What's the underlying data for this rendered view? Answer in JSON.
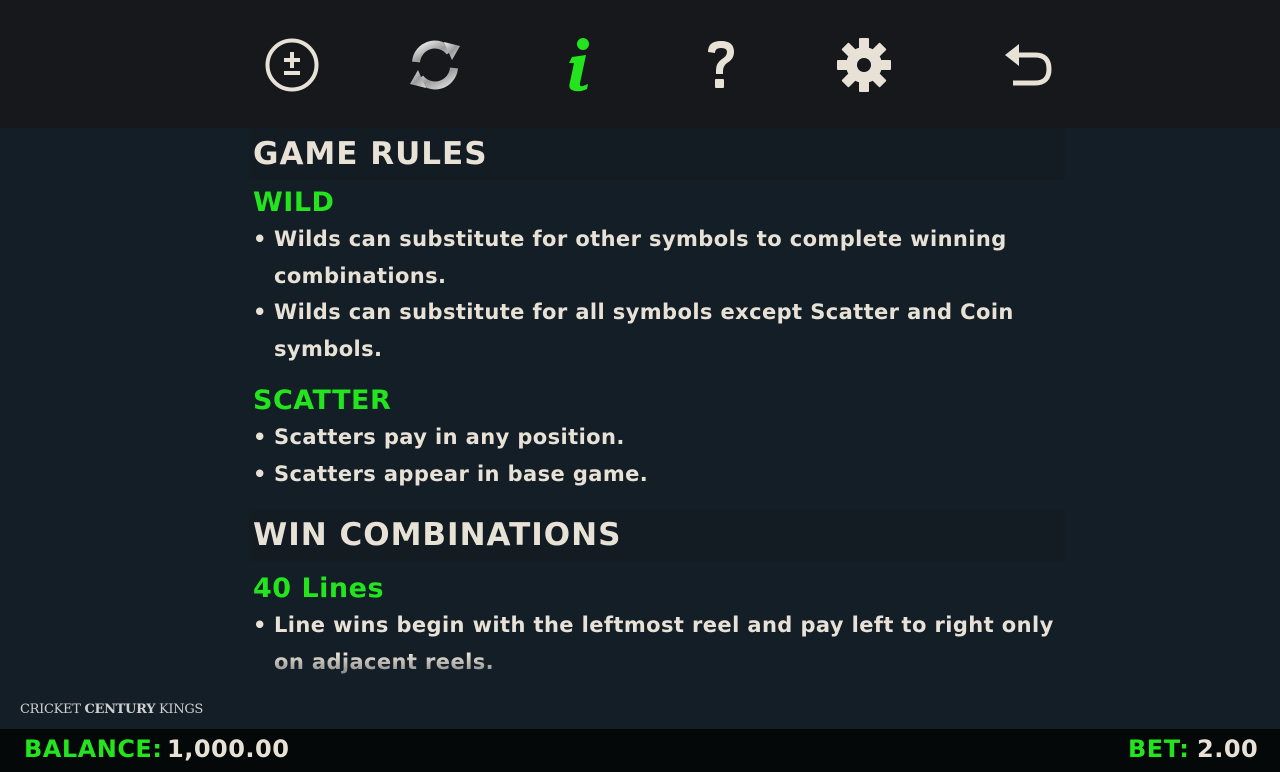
{
  "toolbar": {
    "icons": [
      "plus-minus-icon",
      "autoplay-icon",
      "info-icon",
      "help-icon",
      "settings-icon",
      "back-icon"
    ],
    "active_color": "#22e51e",
    "icon_color": "#e8e2d6"
  },
  "rules": {
    "section1_title": "GAME RULES",
    "wild": {
      "title": "WILD",
      "items": [
        "Wilds can substitute for other symbols to complete winning combinations.",
        "Wilds can substitute for all symbols except Scatter and Coin symbols."
      ]
    },
    "scatter": {
      "title": "SCATTER",
      "items": [
        "Scatters pay in any position.",
        "Scatters appear in base game."
      ]
    },
    "section2_title": "WIN COMBINATIONS",
    "lines": {
      "title": "40 Lines",
      "items": [
        "Line wins begin with the leftmost reel and pay left to right only on adjacent reels."
      ]
    }
  },
  "logo": {
    "left": "CRICKET",
    "middle": "CENTURY",
    "right": "KINGS"
  },
  "footer": {
    "balance_label": "BALANCE:",
    "balance_value": "1,000.00",
    "bet_label": "BET:",
    "bet_value": "2.00"
  }
}
